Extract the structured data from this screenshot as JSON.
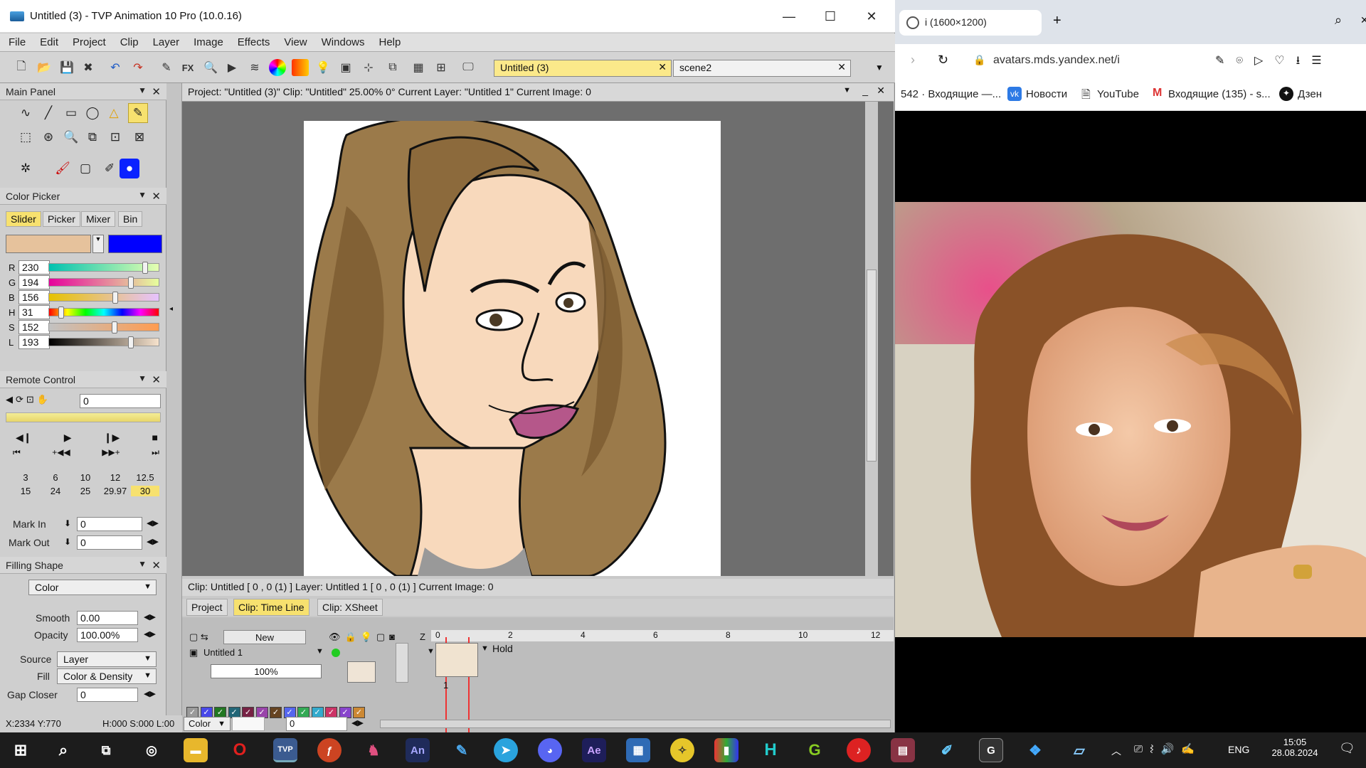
{
  "tvp": {
    "title": "Untitled (3) - TVP Animation 10 Pro (10.0.16)",
    "menu": [
      "File",
      "Edit",
      "Project",
      "Clip",
      "Layer",
      "Image",
      "Effects",
      "View",
      "Windows",
      "Help"
    ],
    "fx_label": "FX",
    "tab_active": "Untitled (3)",
    "tab_scene": "scene2",
    "main_panel": "Main Panel",
    "color_picker": {
      "title": "Color Picker",
      "tabs": [
        "Slider",
        "Picker",
        "Mixer",
        "Bin"
      ],
      "primary_color": "#e6c29c",
      "secondary_color": "#0000ff",
      "sliders": [
        {
          "label": "R",
          "value": "230",
          "frac": 0.9
        },
        {
          "label": "G",
          "value": "194",
          "frac": 0.76
        },
        {
          "label": "B",
          "value": "156",
          "frac": 0.61
        },
        {
          "label": "H",
          "value": "31",
          "frac": 0.09
        },
        {
          "label": "S",
          "value": "152",
          "frac": 0.6
        },
        {
          "label": "L",
          "value": "193",
          "frac": 0.76
        }
      ]
    },
    "remote": {
      "title": "Remote Control",
      "frame_value": "0",
      "fps_row1": [
        "3",
        "6",
        "10",
        "12",
        "12.5"
      ],
      "fps_row2": [
        "15",
        "24",
        "25",
        "29.97",
        "30"
      ]
    },
    "mark_in_label": "Mark In",
    "mark_in_value": "0",
    "mark_out_label": "Mark Out",
    "mark_out_value": "0",
    "filling": {
      "title": "Filling Shape",
      "mode": "Color",
      "smooth_label": "Smooth",
      "smooth_value": "0.00",
      "opacity_label": "Opacity",
      "opacity_value": "100.00%",
      "source_label": "Source",
      "source_value": "Layer",
      "fill_label": "Fill",
      "fill_value": "Color & Density",
      "gap_label": "Gap Closer",
      "gap_value": "0"
    },
    "status_coords": "X:2334  Y:770",
    "status_hsl": "H:000 S:000 L:00",
    "work_header": "Project:  \"Untitled (3)\"  Clip: \"Untitled\"   25.00%   0°   Current Layer: \"Untitled 1\"   Current Image: 0",
    "timeline": {
      "status": "Clip: Untitled [ 0 , 0  (1) ]        Layer: Untitled 1 [ 0 , 0  (1) ]     Current Image: 0",
      "tabs": [
        "Project",
        "Clip: Time Line",
        "Clip: XSheet"
      ],
      "new_label": "New",
      "z_label": "Z",
      "layer_name": "Untitled 1",
      "layer_opacity": "100%",
      "hold_label": "Hold",
      "frame_index": "1",
      "ruler": [
        "0",
        "2",
        "4",
        "6",
        "8",
        "10",
        "12"
      ],
      "color_mode": "Color",
      "bottom_value": "0"
    }
  },
  "browser": {
    "tab_title": "i (1600×1200)",
    "url": "avatars.mds.yandex.net/i",
    "bookmarks": [
      "542 · Входящие —...",
      "Новости",
      "YouTube",
      "Входящие (135) - s...",
      "Дзен"
    ]
  },
  "taskbar": {
    "lang": "ENG",
    "time": "15:05",
    "date": "28.08.2024"
  },
  "chart_data": null
}
